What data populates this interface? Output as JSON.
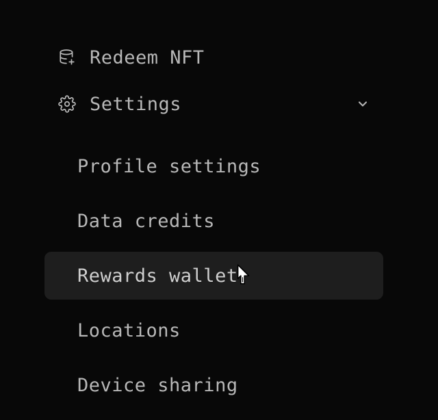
{
  "nav": {
    "redeem_nft": {
      "label": "Redeem NFT",
      "icon": "database-plus-icon"
    },
    "settings": {
      "label": "Settings",
      "icon": "gear-icon",
      "expanded": true
    }
  },
  "settings_submenu": {
    "profile_settings": {
      "label": "Profile settings"
    },
    "data_credits": {
      "label": "Data credits"
    },
    "rewards_wallet": {
      "label": "Rewards wallet",
      "hovered": true
    },
    "locations": {
      "label": "Locations"
    },
    "device_sharing": {
      "label": "Device sharing"
    }
  }
}
